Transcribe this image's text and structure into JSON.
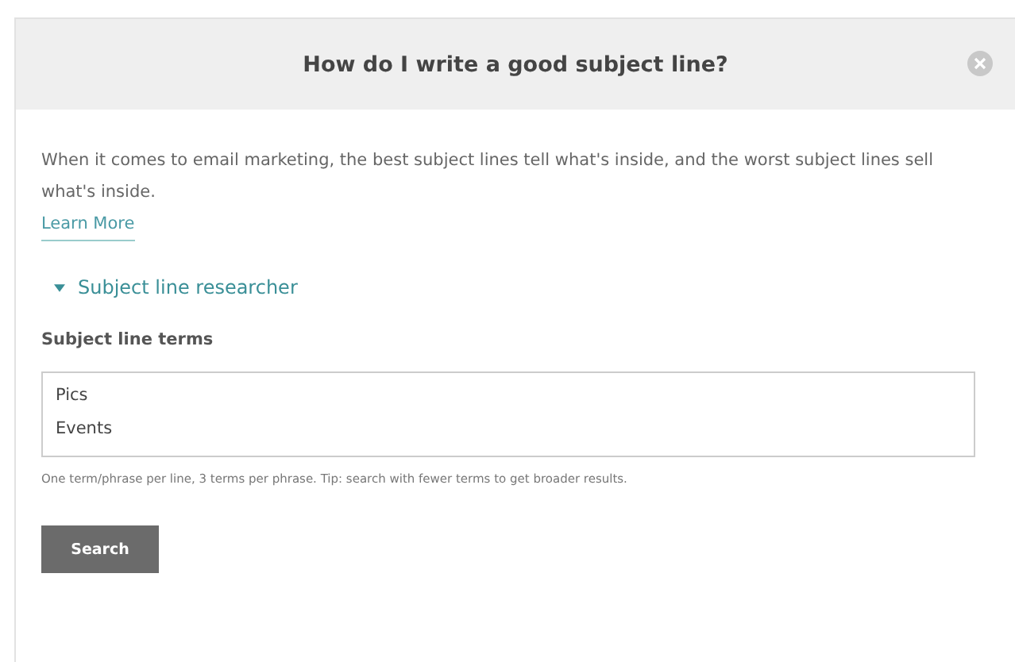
{
  "dialog": {
    "title": "How do I write a good subject line?"
  },
  "intro": "When it comes to email marketing, the best subject lines tell what's inside, and the worst subject lines sell what's inside.",
  "learn_more": "Learn More",
  "researcher": {
    "label": "Subject line researcher",
    "expanded": true
  },
  "terms_field": {
    "label": "Subject line terms",
    "value": "Pics\nEvents",
    "hint": "One term/phrase per line, 3 terms per phrase. Tip: search with fewer terms to get broader results."
  },
  "buttons": [
    "Search"
  ]
}
